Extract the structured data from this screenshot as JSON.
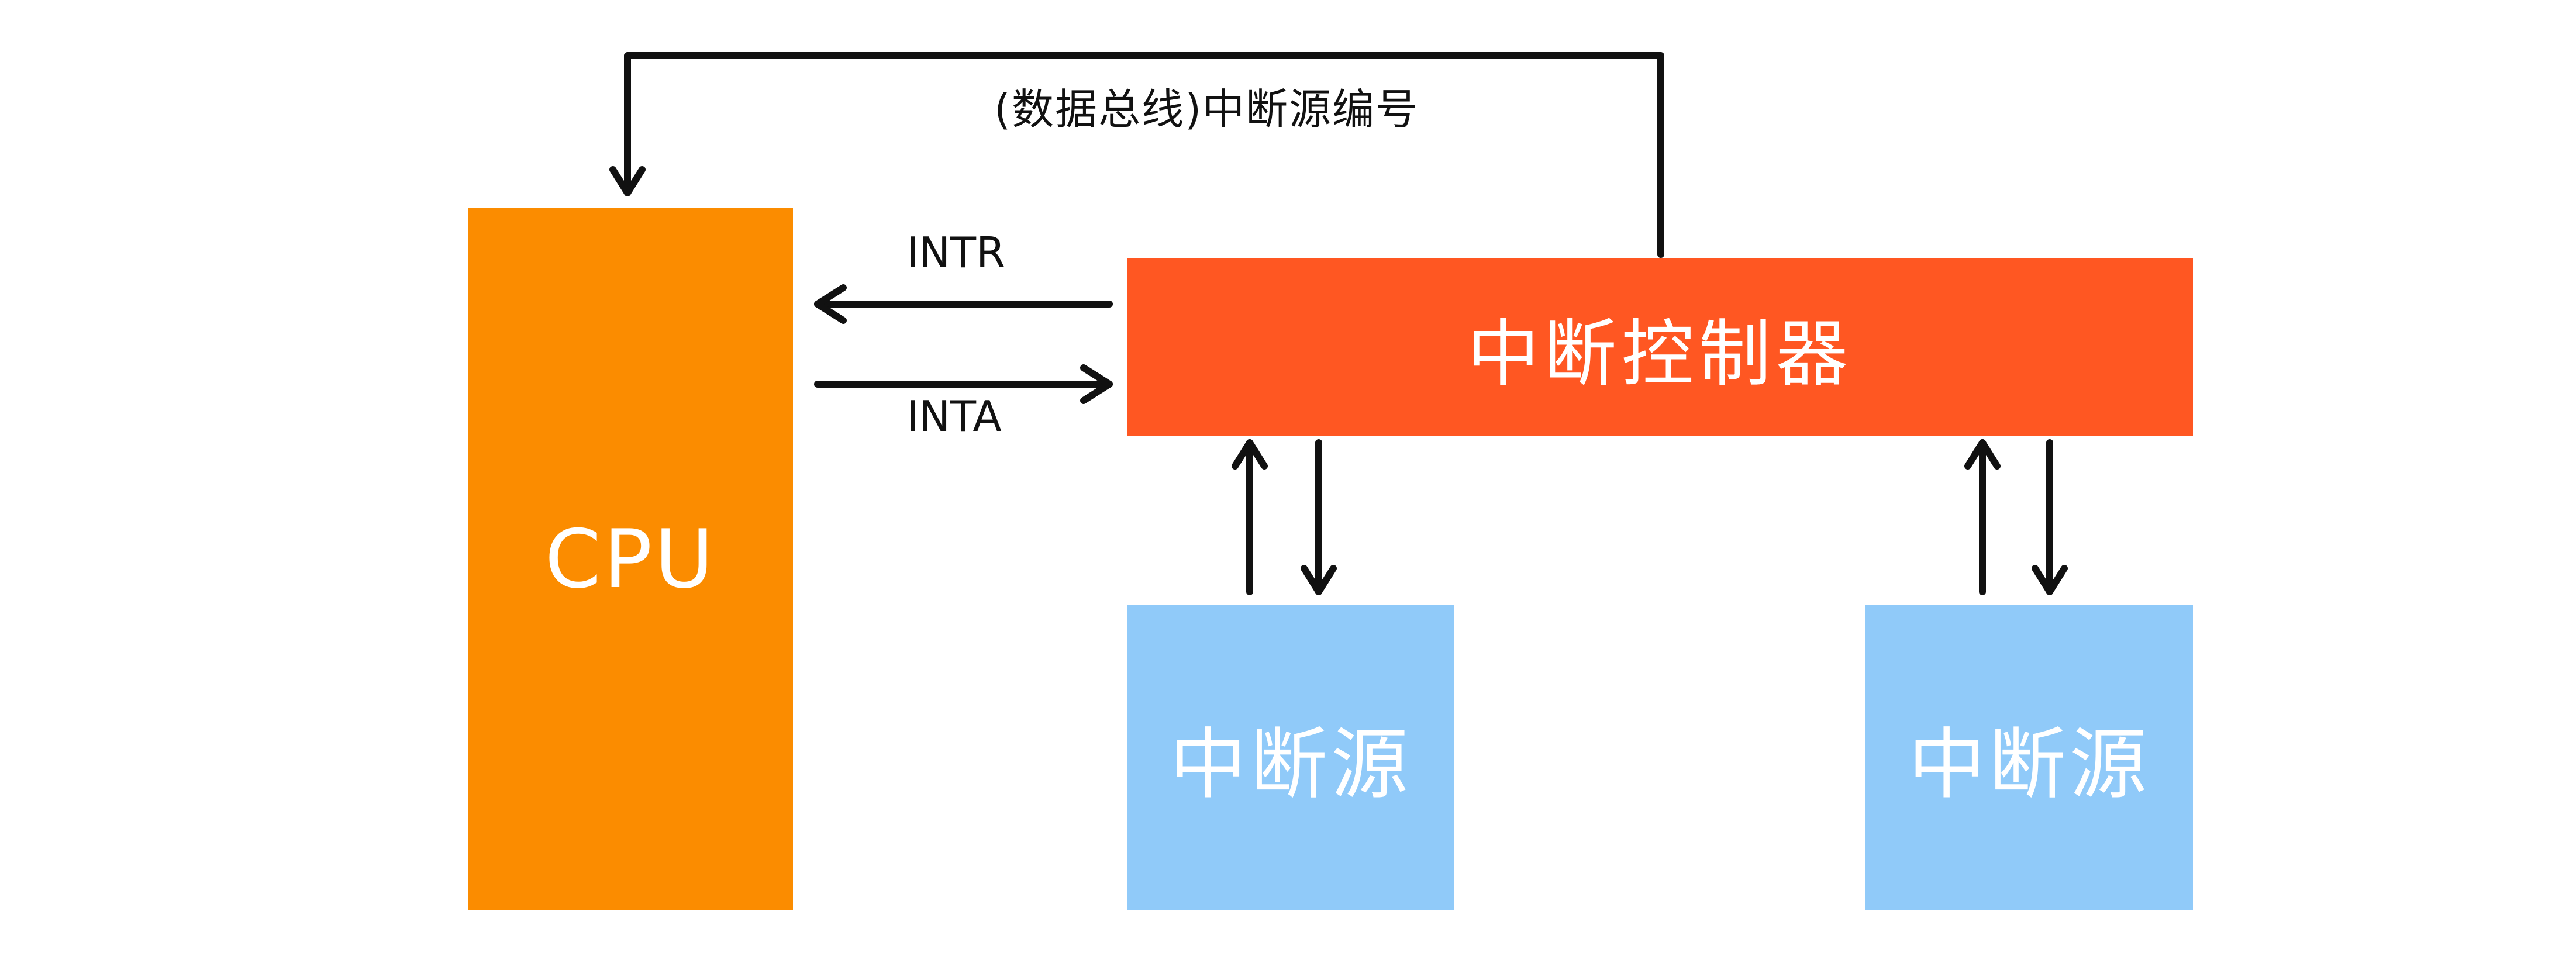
{
  "colors": {
    "cpu": "#FB8C00",
    "controller": "#FF5722",
    "source": "#90CAF9",
    "arrow": "#111111"
  },
  "nodes": {
    "cpu": "CPU",
    "controller": "中断控制器",
    "source_1": "中断源",
    "source_2": "中断源"
  },
  "edges": {
    "bus_label": "(数据总线)中断源编号",
    "intr_label": "INTR",
    "inta_label": "INTA"
  }
}
